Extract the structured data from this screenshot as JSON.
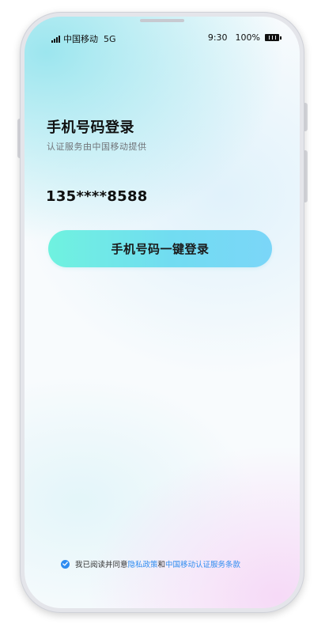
{
  "status_bar": {
    "carrier": "中国移动",
    "network": "5G",
    "time": "9:30",
    "battery_percent": "100%"
  },
  "login": {
    "title": "手机号码登录",
    "subtitle": "认证服务由中国移动提供",
    "masked_phone": "135****8588",
    "button_label": "手机号码一键登录"
  },
  "agreement": {
    "checked": true,
    "prefix": "我已阅读并同意",
    "privacy_link": "隐私政策",
    "joiner": "和",
    "terms_link": "中国移动认证服务条款"
  },
  "colors": {
    "link": "#2f8cf0",
    "button_start": "#6ff2df",
    "button_end": "#7bd6f8"
  },
  "icons": {
    "signal": "signal-bars-icon",
    "battery": "battery-icon",
    "check": "check-circle-icon"
  }
}
